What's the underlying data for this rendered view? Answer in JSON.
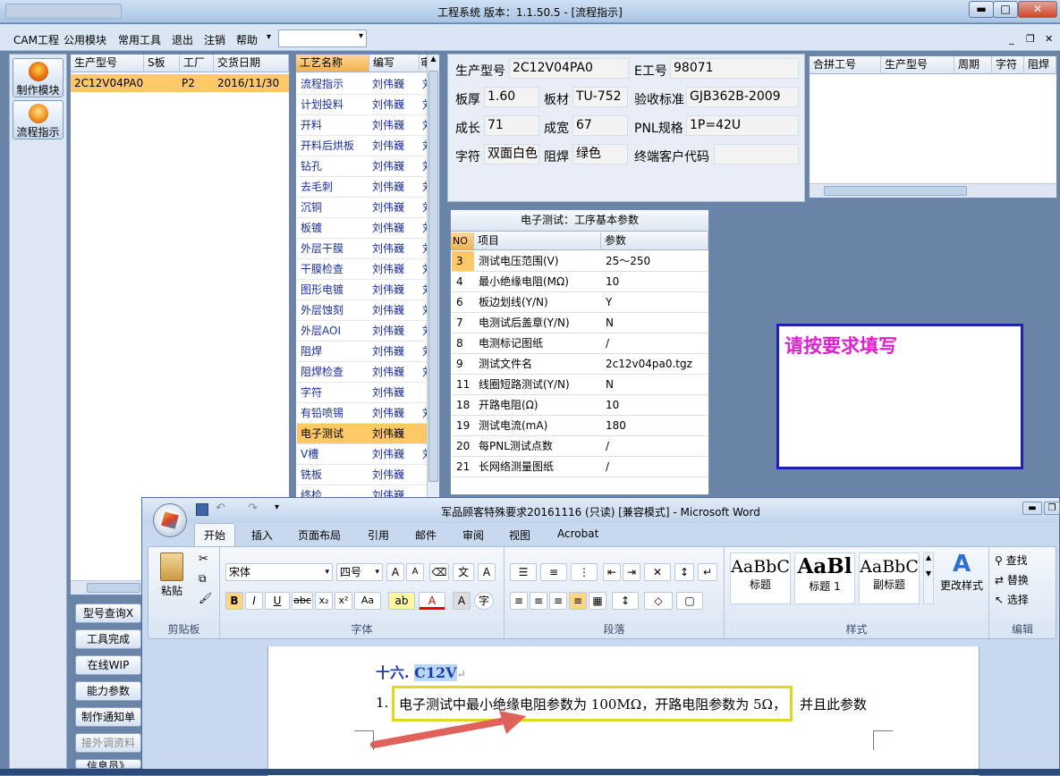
{
  "window": {
    "title": "工程系统  版本：1.1.50.5 - [流程指示]"
  },
  "menu": [
    "CAM工程",
    "公用模块",
    "常用工具",
    "退出",
    "注销",
    "帮助"
  ],
  "menu_more": "▾",
  "left_nav": [
    {
      "label": "制作模块"
    },
    {
      "label": "流程指示"
    }
  ],
  "product_grid": {
    "headers": [
      "生产型号",
      "S板",
      "工厂",
      "交货日期"
    ],
    "rows": [
      [
        "2C12V04PA0",
        "",
        "P2",
        "2016/11/30"
      ]
    ]
  },
  "bottom_buttons": [
    "型号查询X",
    "工具完成",
    "在线WIP",
    "能力参数",
    "制作通知单",
    "接外调资料",
    "信息员》"
  ],
  "process_list": {
    "headers": [
      "工艺名称",
      "编写",
      "审"
    ],
    "rows": [
      {
        "name": "流程指示",
        "writer": "刘伟巍",
        "extra": "刘"
      },
      {
        "name": "计划投料",
        "writer": "刘伟巍",
        "extra": "刘"
      },
      {
        "name": "开料",
        "writer": "刘伟巍",
        "extra": "刘"
      },
      {
        "name": "开料后烘板",
        "writer": "刘伟巍",
        "extra": "刘"
      },
      {
        "name": "钻孔",
        "writer": "刘伟巍",
        "extra": "刘"
      },
      {
        "name": "去毛刺",
        "writer": "刘伟巍",
        "extra": "刘"
      },
      {
        "name": "沉铜",
        "writer": "刘伟巍",
        "extra": "刘"
      },
      {
        "name": "板镀",
        "writer": "刘伟巍",
        "extra": "刘"
      },
      {
        "name": "外层干膜",
        "writer": "刘伟巍",
        "extra": "刘"
      },
      {
        "name": "干膜检查",
        "writer": "刘伟巍",
        "extra": "刘"
      },
      {
        "name": "图形电镀",
        "writer": "刘伟巍",
        "extra": "刘"
      },
      {
        "name": "外层蚀刻",
        "writer": "刘伟巍",
        "extra": "刘"
      },
      {
        "name": "外层AOI",
        "writer": "刘伟巍",
        "extra": "刘"
      },
      {
        "name": "阻焊",
        "writer": "刘伟巍",
        "extra": "刘"
      },
      {
        "name": "阻焊检查",
        "writer": "刘伟巍",
        "extra": "刘"
      },
      {
        "name": "字符",
        "writer": "刘伟巍",
        "extra": ""
      },
      {
        "name": "有铅喷锡",
        "writer": "刘伟巍",
        "extra": "刘"
      },
      {
        "name": "电子测试",
        "writer": "刘伟巍",
        "extra": ""
      },
      {
        "name": "V槽",
        "writer": "刘伟巍",
        "extra": "刘"
      },
      {
        "name": "铣板",
        "writer": "刘伟巍",
        "extra": ""
      },
      {
        "name": "终检",
        "writer": "刘伟巍",
        "extra": ""
      }
    ]
  },
  "info": {
    "model_label": "生产型号",
    "model": "2C12V04PA0",
    "e_label": "E工号",
    "e_no": "98071",
    "thickness_label": "板厚",
    "thickness": "1.60",
    "material_label": "板材",
    "material": "TU-752",
    "standard_label": "验收标准",
    "standard": "GJB362B-2009",
    "length_label": "成长",
    "length": "71",
    "width_label": "成宽",
    "width": "67",
    "pnl_label": "PNL规格",
    "pnl": "1P=42U",
    "char_label": "字符",
    "char": "双面白色",
    "mask_label": "阻焊",
    "mask": "绿色",
    "client_label": "终端客户代码",
    "client": ""
  },
  "merge_table": {
    "headers": [
      "合拼工号",
      "生产型号",
      "周期",
      "字符",
      "阻焊"
    ]
  },
  "param_table": {
    "title": "电子测试：工序基本参数",
    "headers": [
      "NO",
      "项目",
      "参数"
    ],
    "rows": [
      [
        "3",
        "测试电压范围(V)",
        "25～250"
      ],
      [
        "4",
        "最小绝缘电阻(MΩ)",
        "10"
      ],
      [
        "6",
        "板边划线(Y/N)",
        "Y"
      ],
      [
        "7",
        "电测试后盖章(Y/N)",
        "N"
      ],
      [
        "8",
        "电测标记图纸",
        "/"
      ],
      [
        "9",
        "测试文件名",
        "2c12v04pa0.tgz"
      ],
      [
        "11",
        "线圈短路测试(Y/N)",
        "N"
      ],
      [
        "18",
        "开路电阻(Ω)",
        "10"
      ],
      [
        "19",
        "测试电流(mA)",
        "180"
      ],
      [
        "20",
        "每PNL测试点数",
        "/"
      ],
      [
        "21",
        "长网络测量图纸",
        "/"
      ]
    ]
  },
  "notice": {
    "text": "请按要求填写"
  },
  "word": {
    "title": "军品顾客特殊要求20161116 (只读) [兼容模式] - Microsoft Word",
    "tabs": [
      "开始",
      "插入",
      "页面布局",
      "引用",
      "邮件",
      "审阅",
      "视图",
      "Acrobat"
    ],
    "clipboard": {
      "paste": "粘贴",
      "label": "剪贴板"
    },
    "font": {
      "name": "宋体",
      "size": "四号",
      "label": "字体"
    },
    "paragraph_label": "段落",
    "styles": {
      "items": [
        {
          "sample": "AaBbC",
          "name": "标题"
        },
        {
          "sample": "AaBl",
          "name": "标题 1"
        },
        {
          "sample": "AaBbC",
          "name": "副标题"
        }
      ],
      "change": "更改样式",
      "label": "样式"
    },
    "editing": {
      "find": "查找",
      "replace": "替换",
      "select": "选择",
      "label": "编辑"
    },
    "doc": {
      "heading": "十六.",
      "heading_highlight": "C12V",
      "item_no": "1.",
      "boxed_text": "电子测试中最小绝缘电阻参数为 100MΩ，开路电阻参数为 5Ω，",
      "text_after": "并且此参数"
    }
  }
}
